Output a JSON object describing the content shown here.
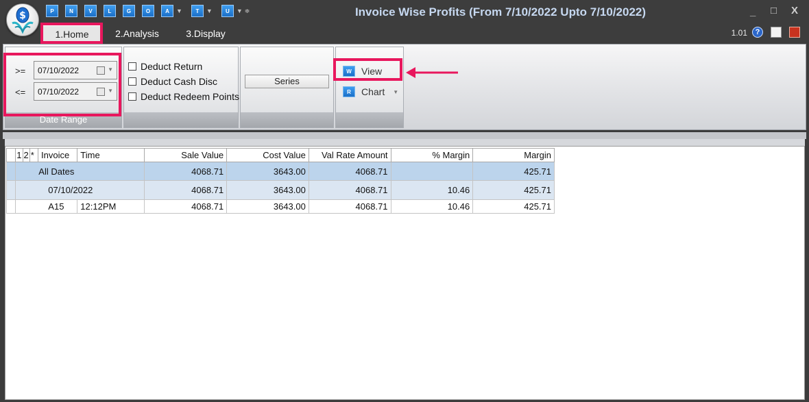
{
  "window": {
    "title": "Invoice Wise Profits (From 7/10/2022 Upto 7/10/2022)",
    "controls": [
      "_",
      "□",
      "X"
    ]
  },
  "quick_access": [
    "P",
    "N",
    "V",
    "L",
    "G",
    "O",
    "A",
    "T",
    "U"
  ],
  "tabs": [
    "1.Home",
    "2.Analysis",
    "3.Display"
  ],
  "version": "1.01",
  "date_range": {
    "from_op": ">=",
    "to_op": "<=",
    "from": "07/10/2022",
    "to": "07/10/2022",
    "caption": "Date Range"
  },
  "options": {
    "deduct_return": "Deduct Return",
    "deduct_cash_disc": "Deduct Cash Disc",
    "deduct_redeem_points": "Deduct Redeem Points"
  },
  "series": {
    "label": "Series"
  },
  "actions": {
    "view": "View",
    "view_icon": "W",
    "chart": "Chart",
    "chart_icon": "R"
  },
  "grid": {
    "headers": [
      "1",
      "2",
      "*",
      "Invoice",
      "Time",
      "Sale Value",
      "Cost Value",
      "Val Rate Amount",
      "% Margin",
      "Margin"
    ],
    "rows": [
      [
        "All Dates",
        "",
        "4068.71",
        "3643.00",
        "4068.71",
        "",
        "425.71"
      ],
      [
        "07/10/2022",
        "",
        "4068.71",
        "3643.00",
        "4068.71",
        "10.46",
        "425.71"
      ],
      [
        "A15",
        "12:12PM",
        "4068.71",
        "3643.00",
        "4068.71",
        "10.46",
        "425.71"
      ]
    ]
  },
  "colors": {
    "highlight": "#e8175d",
    "title_text": "#c6d8f0",
    "icon_blue": "#1a6fc8"
  }
}
